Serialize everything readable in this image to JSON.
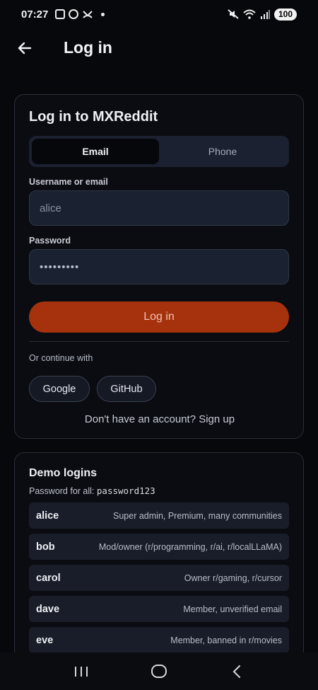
{
  "status_bar": {
    "time": "07:27",
    "battery": "100",
    "icons": [
      "screenshot-icon",
      "whatsapp-icon",
      "missed-call-icon",
      "notification-dot",
      "mute-icon",
      "wifi-icon",
      "signal-icon"
    ]
  },
  "app_bar": {
    "title": "Log in",
    "back_icon": "arrow-left-icon"
  },
  "login": {
    "title": "Log in to MXReddit",
    "tabs": [
      {
        "label": "Email",
        "active": true
      },
      {
        "label": "Phone",
        "active": false
      }
    ],
    "username_label": "Username or email",
    "username_value": "alice",
    "password_label": "Password",
    "password_value": "•••••••••",
    "submit_label": "Log in",
    "or_text": "Or continue with",
    "google_label": "Google",
    "github_label": "GitHub",
    "signup_text": "Don't have an account? Sign up"
  },
  "demo": {
    "title": "Demo logins",
    "password_hint_prefix": "Password for all:",
    "password_hint_value": "password123",
    "accounts": [
      {
        "name": "alice",
        "desc": "Super admin, Premium, many communities"
      },
      {
        "name": "bob",
        "desc": "Mod/owner (r/programming, r/ai, r/localLLaMA)"
      },
      {
        "name": "carol",
        "desc": "Owner r/gaming, r/cursor"
      },
      {
        "name": "dave",
        "desc": "Member, unverified email"
      },
      {
        "name": "eve",
        "desc": "Member, banned in r/movies"
      }
    ]
  },
  "colors": {
    "accent": "#a5320c",
    "background": "#07080c",
    "card": "#0a0c11",
    "field": "#1a2130"
  },
  "nav": {
    "icons": [
      "recent-apps-icon",
      "home-icon",
      "back-icon"
    ]
  }
}
